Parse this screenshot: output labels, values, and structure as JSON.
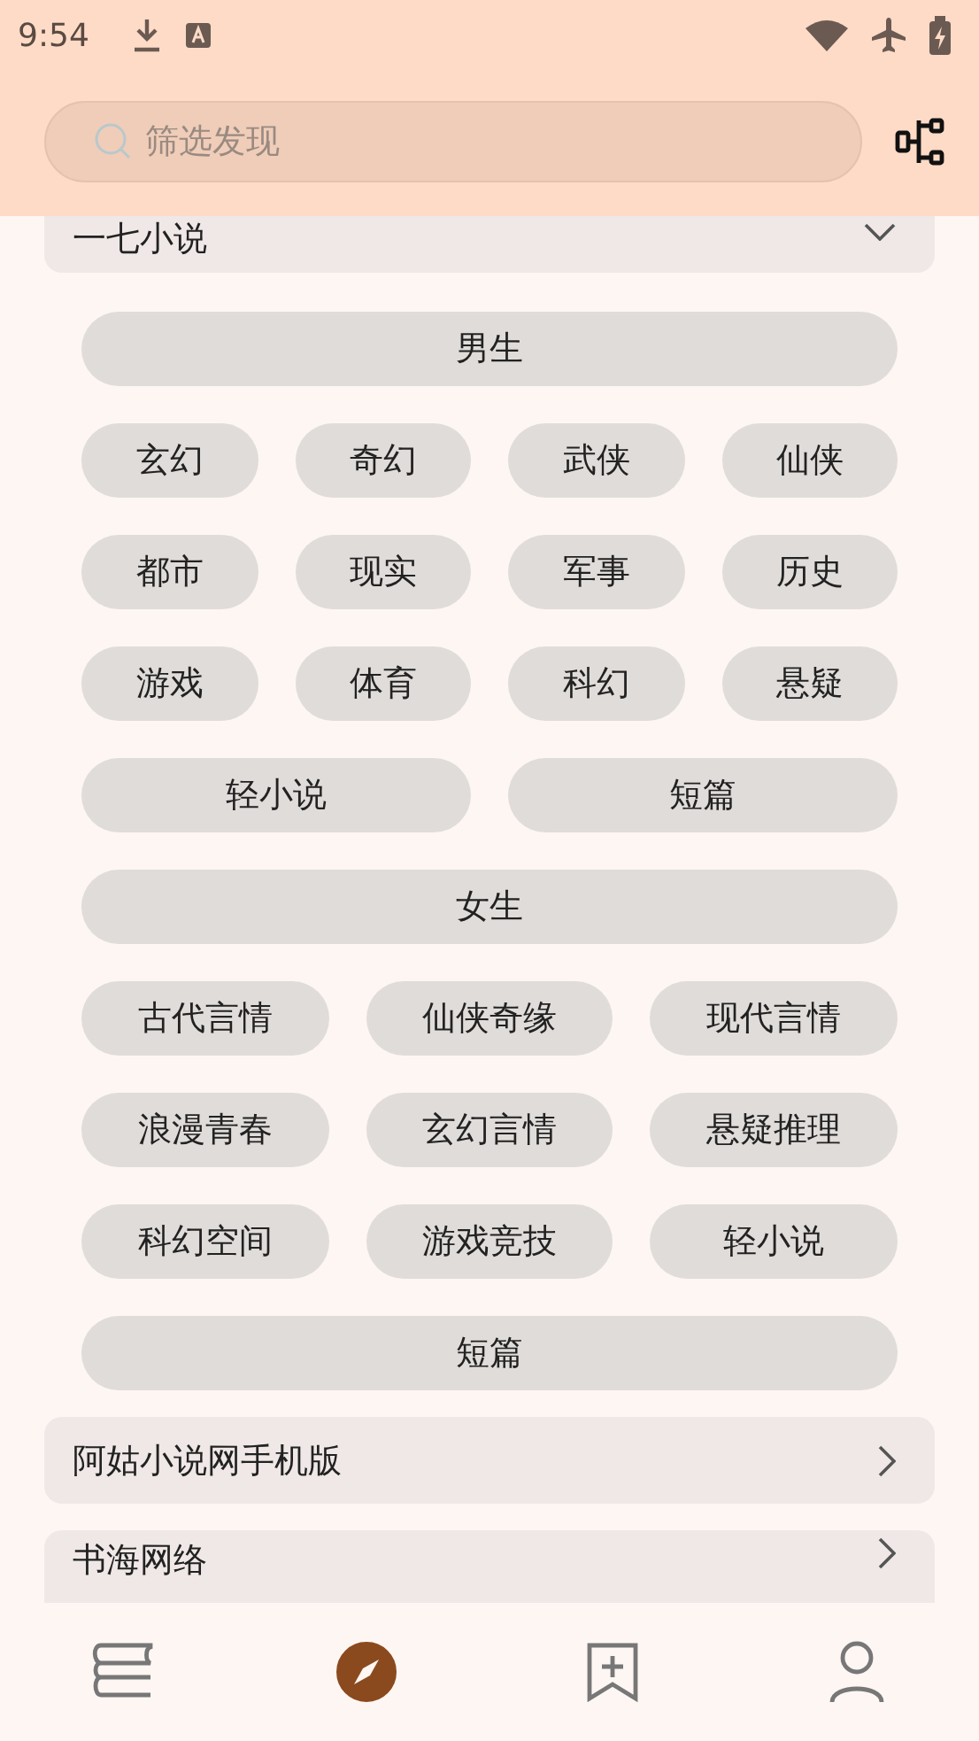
{
  "status_bar": {
    "time": "9:54"
  },
  "search": {
    "placeholder": "筛选发现"
  },
  "sources": [
    {
      "name": "一七小说",
      "expanded": true,
      "rows": [
        {
          "tags": [
            "男生"
          ]
        },
        {
          "tags": [
            "玄幻",
            "奇幻",
            "武侠",
            "仙侠"
          ]
        },
        {
          "tags": [
            "都市",
            "现实",
            "军事",
            "历史"
          ]
        },
        {
          "tags": [
            "游戏",
            "体育",
            "科幻",
            "悬疑"
          ]
        },
        {
          "tags": [
            "轻小说",
            "短篇"
          ]
        },
        {
          "tags": [
            "女生"
          ]
        },
        {
          "tags": [
            "古代言情",
            "仙侠奇缘",
            "现代言情"
          ]
        },
        {
          "tags": [
            "浪漫青春",
            "玄幻言情",
            "悬疑推理"
          ]
        },
        {
          "tags": [
            "科幻空间",
            "游戏竞技",
            "轻小说"
          ]
        },
        {
          "tags": [
            "短篇"
          ]
        }
      ]
    },
    {
      "name": "阿姑小说网手机版",
      "expanded": false
    },
    {
      "name": "书海网络",
      "expanded": false
    }
  ],
  "nav": [
    {
      "kind": "bookshelf",
      "selected": false
    },
    {
      "kind": "explore",
      "selected": true
    },
    {
      "kind": "subscribe",
      "selected": false
    },
    {
      "kind": "profile",
      "selected": false
    }
  ]
}
